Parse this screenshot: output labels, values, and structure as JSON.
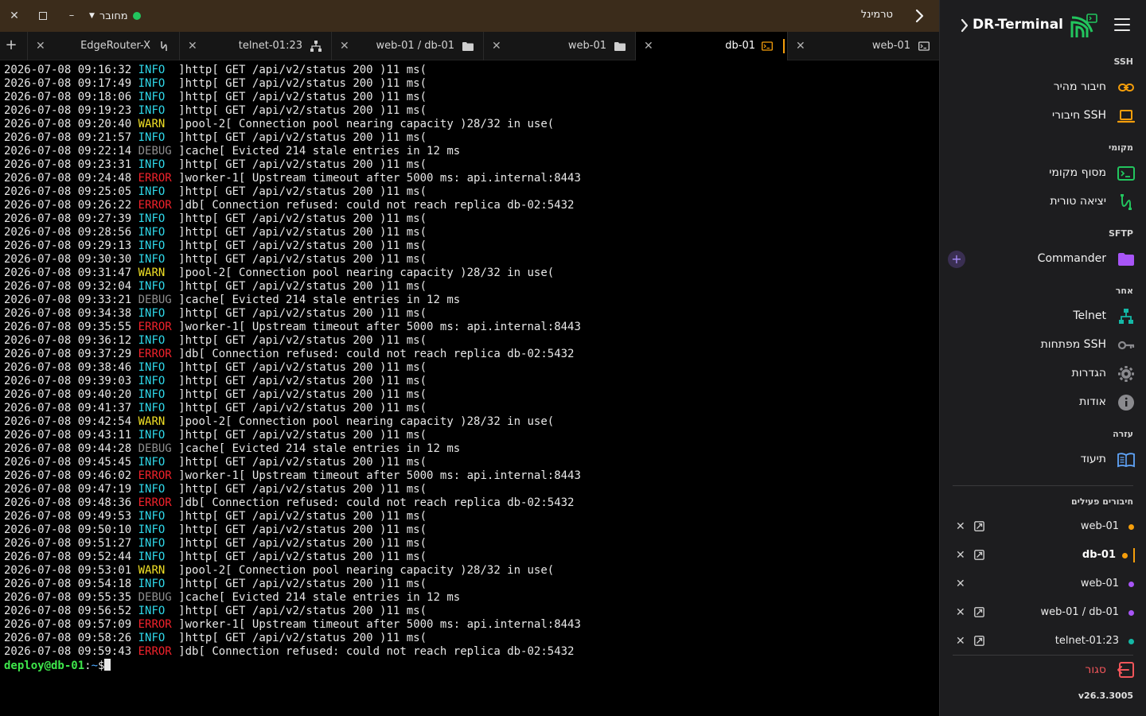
{
  "window": {
    "title": "טרמינל",
    "connection_status": "מחובר",
    "status_color": "#22c55e"
  },
  "tabs": [
    {
      "label": "EdgeRouter-X",
      "icon": "serial-icon",
      "active": false
    },
    {
      "label": "telnet-01:23",
      "icon": "network-icon",
      "active": false
    },
    {
      "label": "web-01 / db-01",
      "icon": "folder-icon",
      "active": false
    },
    {
      "label": "web-01",
      "icon": "folder-icon",
      "active": false
    },
    {
      "label": "db-01",
      "icon": "terminal-icon",
      "active": true
    },
    {
      "label": "web-01",
      "icon": "terminal-icon",
      "active": false
    }
  ],
  "terminal": {
    "lines": [
      {
        "ts": "2026-07-08 09:16:32",
        "level": "INFO",
        "msg": "]http[ GET /api/v2/status 200 )11 ms("
      },
      {
        "ts": "2026-07-08 09:17:49",
        "level": "INFO",
        "msg": "]http[ GET /api/v2/status 200 )11 ms("
      },
      {
        "ts": "2026-07-08 09:18:06",
        "level": "INFO",
        "msg": "]http[ GET /api/v2/status 200 )11 ms("
      },
      {
        "ts": "2026-07-08 09:19:23",
        "level": "INFO",
        "msg": "]http[ GET /api/v2/status 200 )11 ms("
      },
      {
        "ts": "2026-07-08 09:20:40",
        "level": "WARN",
        "msg": "]pool-2[ Connection pool nearing capacity )28/32 in use("
      },
      {
        "ts": "2026-07-08 09:21:57",
        "level": "INFO",
        "msg": "]http[ GET /api/v2/status 200 )11 ms("
      },
      {
        "ts": "2026-07-08 09:22:14",
        "level": "DEBUG",
        "msg": "]cache[ Evicted 214 stale entries in 12 ms"
      },
      {
        "ts": "2026-07-08 09:23:31",
        "level": "INFO",
        "msg": "]http[ GET /api/v2/status 200 )11 ms("
      },
      {
        "ts": "2026-07-08 09:24:48",
        "level": "ERROR",
        "msg": "]worker-1[ Upstream timeout after 5000 ms: api.internal:8443"
      },
      {
        "ts": "2026-07-08 09:25:05",
        "level": "INFO",
        "msg": "]http[ GET /api/v2/status 200 )11 ms("
      },
      {
        "ts": "2026-07-08 09:26:22",
        "level": "ERROR",
        "msg": "]db[ Connection refused: could not reach replica db-02:5432"
      },
      {
        "ts": "2026-07-08 09:27:39",
        "level": "INFO",
        "msg": "]http[ GET /api/v2/status 200 )11 ms("
      },
      {
        "ts": "2026-07-08 09:28:56",
        "level": "INFO",
        "msg": "]http[ GET /api/v2/status 200 )11 ms("
      },
      {
        "ts": "2026-07-08 09:29:13",
        "level": "INFO",
        "msg": "]http[ GET /api/v2/status 200 )11 ms("
      },
      {
        "ts": "2026-07-08 09:30:30",
        "level": "INFO",
        "msg": "]http[ GET /api/v2/status 200 )11 ms("
      },
      {
        "ts": "2026-07-08 09:31:47",
        "level": "WARN",
        "msg": "]pool-2[ Connection pool nearing capacity )28/32 in use("
      },
      {
        "ts": "2026-07-08 09:32:04",
        "level": "INFO",
        "msg": "]http[ GET /api/v2/status 200 )11 ms("
      },
      {
        "ts": "2026-07-08 09:33:21",
        "level": "DEBUG",
        "msg": "]cache[ Evicted 214 stale entries in 12 ms"
      },
      {
        "ts": "2026-07-08 09:34:38",
        "level": "INFO",
        "msg": "]http[ GET /api/v2/status 200 )11 ms("
      },
      {
        "ts": "2026-07-08 09:35:55",
        "level": "ERROR",
        "msg": "]worker-1[ Upstream timeout after 5000 ms: api.internal:8443"
      },
      {
        "ts": "2026-07-08 09:36:12",
        "level": "INFO",
        "msg": "]http[ GET /api/v2/status 200 )11 ms("
      },
      {
        "ts": "2026-07-08 09:37:29",
        "level": "ERROR",
        "msg": "]db[ Connection refused: could not reach replica db-02:5432"
      },
      {
        "ts": "2026-07-08 09:38:46",
        "level": "INFO",
        "msg": "]http[ GET /api/v2/status 200 )11 ms("
      },
      {
        "ts": "2026-07-08 09:39:03",
        "level": "INFO",
        "msg": "]http[ GET /api/v2/status 200 )11 ms("
      },
      {
        "ts": "2026-07-08 09:40:20",
        "level": "INFO",
        "msg": "]http[ GET /api/v2/status 200 )11 ms("
      },
      {
        "ts": "2026-07-08 09:41:37",
        "level": "INFO",
        "msg": "]http[ GET /api/v2/status 200 )11 ms("
      },
      {
        "ts": "2026-07-08 09:42:54",
        "level": "WARN",
        "msg": "]pool-2[ Connection pool nearing capacity )28/32 in use("
      },
      {
        "ts": "2026-07-08 09:43:11",
        "level": "INFO",
        "msg": "]http[ GET /api/v2/status 200 )11 ms("
      },
      {
        "ts": "2026-07-08 09:44:28",
        "level": "DEBUG",
        "msg": "]cache[ Evicted 214 stale entries in 12 ms"
      },
      {
        "ts": "2026-07-08 09:45:45",
        "level": "INFO",
        "msg": "]http[ GET /api/v2/status 200 )11 ms("
      },
      {
        "ts": "2026-07-08 09:46:02",
        "level": "ERROR",
        "msg": "]worker-1[ Upstream timeout after 5000 ms: api.internal:8443"
      },
      {
        "ts": "2026-07-08 09:47:19",
        "level": "INFO",
        "msg": "]http[ GET /api/v2/status 200 )11 ms("
      },
      {
        "ts": "2026-07-08 09:48:36",
        "level": "ERROR",
        "msg": "]db[ Connection refused: could not reach replica db-02:5432"
      },
      {
        "ts": "2026-07-08 09:49:53",
        "level": "INFO",
        "msg": "]http[ GET /api/v2/status 200 )11 ms("
      },
      {
        "ts": "2026-07-08 09:50:10",
        "level": "INFO",
        "msg": "]http[ GET /api/v2/status 200 )11 ms("
      },
      {
        "ts": "2026-07-08 09:51:27",
        "level": "INFO",
        "msg": "]http[ GET /api/v2/status 200 )11 ms("
      },
      {
        "ts": "2026-07-08 09:52:44",
        "level": "INFO",
        "msg": "]http[ GET /api/v2/status 200 )11 ms("
      },
      {
        "ts": "2026-07-08 09:53:01",
        "level": "WARN",
        "msg": "]pool-2[ Connection pool nearing capacity )28/32 in use("
      },
      {
        "ts": "2026-07-08 09:54:18",
        "level": "INFO",
        "msg": "]http[ GET /api/v2/status 200 )11 ms("
      },
      {
        "ts": "2026-07-08 09:55:35",
        "level": "DEBUG",
        "msg": "]cache[ Evicted 214 stale entries in 12 ms"
      },
      {
        "ts": "2026-07-08 09:56:52",
        "level": "INFO",
        "msg": "]http[ GET /api/v2/status 200 )11 ms("
      },
      {
        "ts": "2026-07-08 09:57:09",
        "level": "ERROR",
        "msg": "]worker-1[ Upstream timeout after 5000 ms: api.internal:8443"
      },
      {
        "ts": "2026-07-08 09:58:26",
        "level": "INFO",
        "msg": "]http[ GET /api/v2/status 200 )11 ms("
      },
      {
        "ts": "2026-07-08 09:59:43",
        "level": "ERROR",
        "msg": "]db[ Connection refused: could not reach replica db-02:5432"
      }
    ],
    "prompt": {
      "user_host": "deploy@db-01",
      "sep": ":",
      "path": "~",
      "symbol": "$"
    }
  },
  "sidebar": {
    "app_name": "DR-Terminal",
    "sections": {
      "ssh": "SSH",
      "local": "מקומי",
      "sftp": "SFTP",
      "other": "אחר",
      "help": "עזרה",
      "active": "חיבורים פעילים"
    },
    "items": {
      "quick_connect": {
        "label": "חיבור מהיר",
        "icon": "link-icon"
      },
      "ssh_connections": {
        "label": "חיבורי SSH",
        "icon": "laptop-icon"
      },
      "local_terminal": {
        "label": "מסוף מקומי",
        "icon": "terminal-icon"
      },
      "serial_out": {
        "label": "יציאה טורית",
        "icon": "serial-icon"
      },
      "commander": {
        "label": "Commander",
        "icon": "folder-icon",
        "add_label": "+"
      },
      "telnet": {
        "label": "Telnet",
        "icon": "network-icon"
      },
      "ssh_keys": {
        "label": "מפתחות SSH",
        "icon": "key-icon"
      },
      "settings": {
        "label": "הגדרות",
        "icon": "gear-icon"
      },
      "about": {
        "label": "אודות",
        "icon": "info-icon"
      },
      "docs": {
        "label": "תיעוד",
        "icon": "book-icon"
      }
    },
    "sessions": [
      {
        "name": "web-01",
        "dot_color": "#f59e0b",
        "active": false,
        "popout": true
      },
      {
        "name": "db-01",
        "dot_color": "#f59e0b",
        "active": true,
        "popout": true
      },
      {
        "name": "web-01",
        "dot_color": "#a855f7",
        "active": false,
        "popout": false
      },
      {
        "name": "web-01 / db-01",
        "dot_color": "#a855f7",
        "active": false,
        "popout": true
      },
      {
        "name": "telnet-01:23",
        "dot_color": "#14b8a6",
        "active": false,
        "popout": true
      }
    ],
    "disconnect_label": "סגור",
    "version": "v26.3.3005"
  },
  "colors": {
    "accent_orange": "#f59e0b",
    "accent_purple": "#a855f7",
    "accent_green": "#22c55e",
    "accent_teal": "#14b8a6",
    "danger": "#f0555a"
  }
}
